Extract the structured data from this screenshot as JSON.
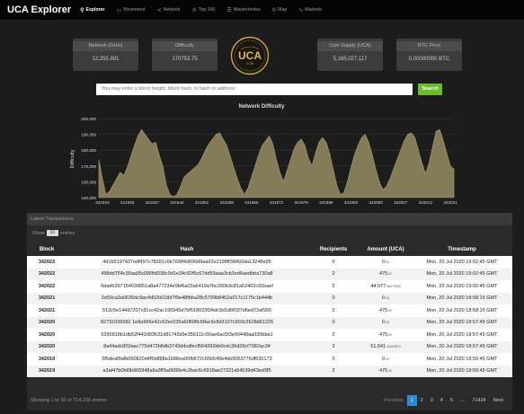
{
  "nav": {
    "brand": "UCA Explorer",
    "items": [
      {
        "label": "Explorer",
        "icon": "search-icon",
        "glyph": "⚲",
        "active": true
      },
      {
        "label": "Movement",
        "icon": "movement-icon",
        "glyph": "▭",
        "active": false
      },
      {
        "label": "Network",
        "icon": "network-icon",
        "glyph": "≺",
        "active": false
      },
      {
        "label": "Top 100",
        "icon": "trophy-icon",
        "glyph": "♔",
        "active": false
      },
      {
        "label": "Masternodes",
        "icon": "list-icon",
        "glyph": "☰",
        "active": false
      },
      {
        "label": "Map",
        "icon": "map-pin-icon",
        "glyph": "⚲",
        "active": false
      },
      {
        "label": "Markets",
        "icon": "chart-icon",
        "glyph": "∿",
        "active": false
      }
    ]
  },
  "stats": {
    "network": {
      "label": "Network (GH/s)",
      "value": "12,255.891"
    },
    "difficulty": {
      "label": "Difficulty",
      "value": "170753.75"
    },
    "supply": {
      "label": "Coin Supply (UCA)",
      "value": "5,165,027,117"
    },
    "btc": {
      "label": "BTC Price",
      "value": "0.00000000 BTC"
    }
  },
  "logo": {
    "text": "UCA",
    "subtext": "COIN"
  },
  "search": {
    "placeholder": "You may enter a block height, block hash, tx hash or address.",
    "button": "Search"
  },
  "chart_data": {
    "type": "area",
    "title": "Network Difficulty",
    "ylabel": "Difficulty",
    "ylim": [
      150000,
      200000
    ],
    "yticks": [
      150000,
      160000,
      170000,
      180000,
      190000,
      200000
    ],
    "ytick_labels": [
      "150,000",
      "160,000",
      "170,000",
      "180,000",
      "190,000",
      "200,000"
    ],
    "xtick_labels": [
      "341923",
      "341930",
      "341937",
      "341944",
      "341951",
      "341958",
      "341965",
      "341972",
      "341979",
      "341986",
      "341993",
      "342000",
      "342007",
      "342014",
      "342021"
    ],
    "x_range": [
      341922,
      342022
    ],
    "values": [
      174000,
      162000,
      152000,
      154000,
      158000,
      162000,
      166000,
      164000,
      169000,
      176000,
      183000,
      189000,
      193000,
      190000,
      187000,
      184000,
      185000,
      177000,
      170000,
      158000,
      152000,
      150500,
      152000,
      157000,
      163000,
      165000,
      167000,
      169000,
      171000,
      175000,
      180000,
      184000,
      187000,
      190000,
      191000,
      187000,
      183000,
      176000,
      169000,
      162000,
      156000,
      152000,
      156000,
      163000,
      170000,
      177000,
      183000,
      186000,
      189000,
      184000,
      174000,
      166000,
      160000,
      167000,
      174000,
      181000,
      185000,
      187000,
      183000,
      175000,
      170000,
      178000,
      185000,
      188000,
      185000,
      178000,
      168000,
      158000,
      152000,
      153000,
      160000,
      169000,
      177000,
      183000,
      188000,
      190000,
      185000,
      177000,
      168000,
      160000,
      155000,
      157000,
      162000,
      168000,
      174000,
      180000,
      186000,
      190000,
      191000,
      188000,
      180000,
      172000,
      165000,
      172000,
      182000,
      192000,
      193000,
      186000,
      178000,
      170000,
      168000
    ],
    "colors": {
      "fill": "#847c59",
      "line": "#a9a276"
    },
    "grid": true
  },
  "table": {
    "heading": "Latest Transactions",
    "show_prefix": "Show",
    "show_value": "10",
    "show_suffix": "entries",
    "columns": [
      "Block",
      "Hash",
      "Recipients",
      "Amount (UCA)",
      "Timestamp"
    ],
    "rows": [
      {
        "block": "342022",
        "hash": "4d1b5197437edf497c78391c6b765ff4d690d9aa92e2198ff38402da13248e95",
        "recipients": "0",
        "amount": "0",
        "amount_dec": ".00",
        "timestamp": "Mon, 20 Jul 2020 19:02:45 GMT"
      },
      {
        "block": "342022",
        "hash": "498dd754c39aa05d389fd338c9d1e34c92f6c67dd59aaa3cb3ed6aedbba730a8",
        "recipients": "2",
        "amount": "475",
        "amount_dec": ".00",
        "timestamp": "Mon, 20 Jul 2020 19:02:45 GMT"
      },
      {
        "block": "342022",
        "hash": "6dad6397154039851a8a477234e9bf6a03a6419a7bc260b3c81a52402c91baef",
        "recipients": "2",
        "amount": "44,977",
        "amount_dec": ".55675095",
        "timestamp": "Mon, 20 Jul 2020 19:02:45 GMT"
      },
      {
        "block": "342021",
        "hash": "2e59ca3a0636dc9ac4d52b018d7f9e48fbba28c5799b8452a017c1175c1b444b",
        "recipients": "0",
        "amount": "0",
        "amount_dec": ".00",
        "timestamp": "Mon, 20 Jul 2020 18:58:15 GMT"
      },
      {
        "block": "342021",
        "hash": "512c5e144d7207c81cc42ac190945d7bf518023f34dc9d1d6f037d6ed73af995",
        "recipients": "2",
        "amount": "475",
        "amount_dec": ".00",
        "timestamp": "Mon, 20 Jul 2020 18:58:15 GMT"
      },
      {
        "block": "342020",
        "hash": "82731036582 1e8a996e42c63ec035a60f08fc68ac9c8d3107c903c2628d61226",
        "recipients": "0",
        "amount": "0",
        "amount_dec": ".00",
        "timestamp": "Mon, 20 Jul 2020 18:57:45 GMT"
      },
      {
        "block": "342020",
        "hash": "6395818b1db52f442d93631d81743d9e356111c60ae6ac5f3e00448aa030bba1",
        "recipients": "2",
        "amount": "475",
        "amount_dec": ".00",
        "timestamp": "Mon, 20 Jul 2020 18:57:45 GMT"
      },
      {
        "block": "342020",
        "hash": "8a44adc8f1faac775d472b8db3743d4cdfecf564392bb0cdc36d39cf7082ac34",
        "recipients": "2",
        "amount": "51,641",
        "amount_dec": ".33342874",
        "timestamp": "Mon, 20 Jul 2020 18:57:45 GMT"
      },
      {
        "block": "342019",
        "hash": "5f5deaf9afb060820d4f5b888a1688ea00fb672c65b545b4bb9063776df630173",
        "recipients": "0",
        "amount": "0",
        "amount_dec": ".00",
        "timestamp": "Mon, 20 Jul 2020 18:56:45 GMT"
      },
      {
        "block": "342019",
        "hash": "a3af47b0fd0b965948a8a3ff3a0690e4c2bac6c6918ae27221a54539d43ed3f5",
        "recipients": "2",
        "amount": "475",
        "amount_dec": ".00",
        "timestamp": "Mon, 20 Jul 2020 18:56:45 GMT"
      }
    ],
    "info": "Showing 1 to 10 of 714,239 entries",
    "pagination": {
      "previous": "Previous",
      "pages": [
        "1",
        "2",
        "3",
        "4",
        "5",
        "…",
        "71424"
      ],
      "active": "1",
      "next": "Next"
    }
  }
}
